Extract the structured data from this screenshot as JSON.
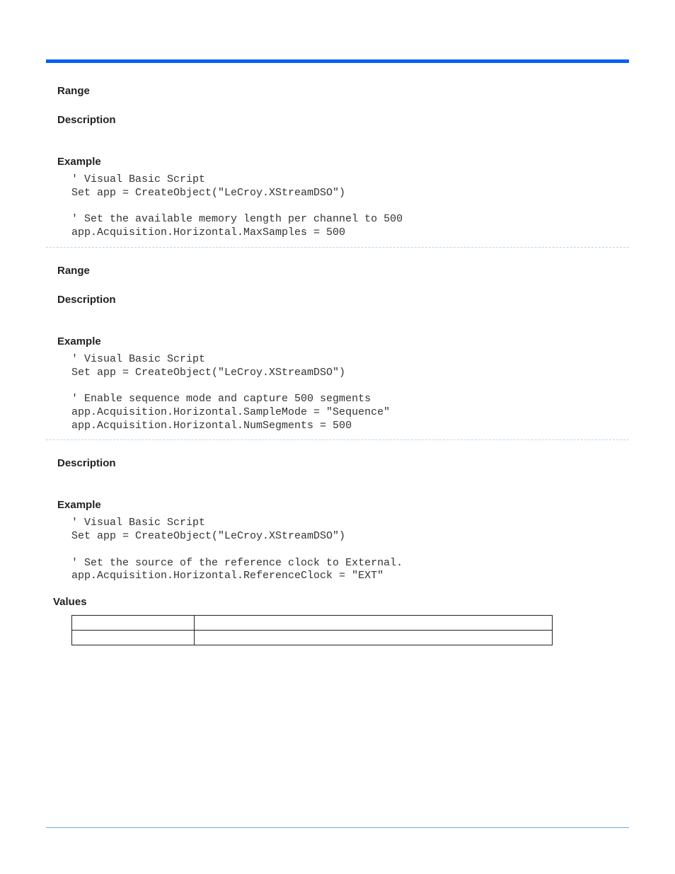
{
  "section1": {
    "range_heading": "Range",
    "description_heading": "Description",
    "example_heading": "Example",
    "code": "' Visual Basic Script\nSet app = CreateObject(\"LeCroy.XStreamDSO\")\n\n' Set the available memory length per channel to 500\napp.Acquisition.Horizontal.MaxSamples = 500"
  },
  "section2": {
    "range_heading": "Range",
    "description_heading": "Description",
    "example_heading": "Example",
    "code": "' Visual Basic Script\nSet app = CreateObject(\"LeCroy.XStreamDSO\")\n\n' Enable sequence mode and capture 500 segments\napp.Acquisition.Horizontal.SampleMode = \"Sequence\"\napp.Acquisition.Horizontal.NumSegments = 500"
  },
  "section3": {
    "description_heading": "Description",
    "example_heading": "Example",
    "code": "' Visual Basic Script\nSet app = CreateObject(\"LeCroy.XStreamDSO\")\n\n' Set the source of the reference clock to External.\napp.Acquisition.Horizontal.ReferenceClock = \"EXT\"",
    "values_heading": "Values",
    "table": {
      "rows": [
        {
          "c1": "",
          "c2": ""
        },
        {
          "c1": "",
          "c2": ""
        }
      ]
    }
  }
}
